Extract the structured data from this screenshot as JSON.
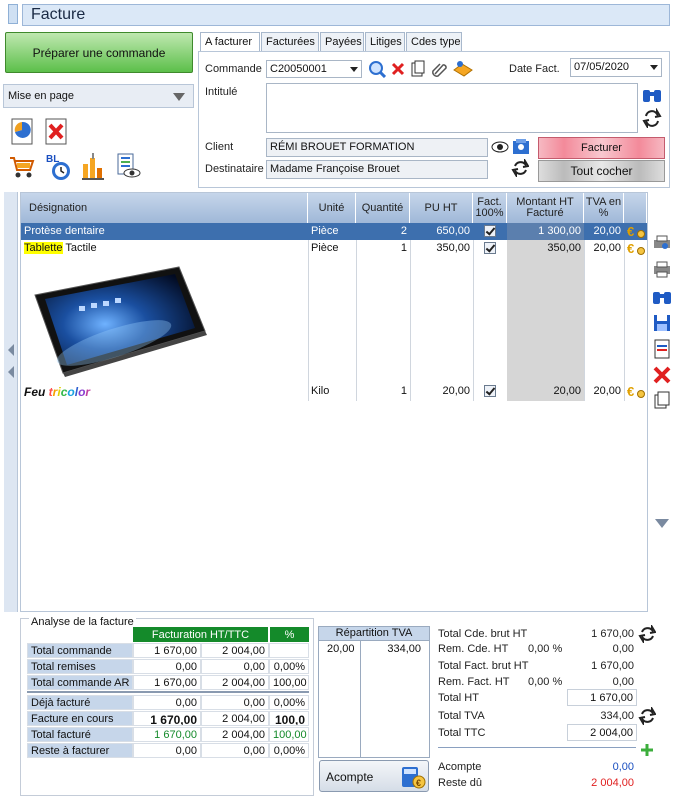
{
  "window": {
    "title": "Facture"
  },
  "left": {
    "prepare_button": "Préparer une commande",
    "mise_en_page": "Mise en page"
  },
  "tabs": [
    "A facturer",
    "Facturées",
    "Payées",
    "Litiges",
    "Cdes type"
  ],
  "form": {
    "commande_label": "Commande",
    "commande_value": "C20050001",
    "date_label": "Date Fact.",
    "date_value": "07/05/2020",
    "intitule_label": "Intitulé",
    "intitule_value": "",
    "client_label": "Client",
    "client_value": "RÉMI BROUET FORMATION",
    "destinataire_label": "Destinataire",
    "destinataire_value": "Madame Françoise Brouet",
    "facturer_button": "Facturer",
    "tout_cocher_button": "Tout cocher"
  },
  "grid": {
    "columns": [
      "Désignation",
      "Unité",
      "Quantité",
      "PU HT",
      "Fact. 100%",
      "Montant HT Facturé",
      "TVA en %"
    ],
    "rows": [
      {
        "designation": "Protèse dentaire",
        "unite": "Pièce",
        "quantite": "2",
        "pu": "650,00",
        "fact": true,
        "montant": "1 300,00",
        "tva": "20,00",
        "selected": true
      },
      {
        "designation_hl": "Tablette",
        "designation_rest": " Tactile",
        "unite": "Pièce",
        "quantite": "1",
        "pu": "350,00",
        "fact": true,
        "montant": "350,00",
        "tva": "20,00"
      },
      {
        "designation_parts": [
          "Feu ",
          "t",
          "r",
          "i",
          "c",
          "o",
          "l",
          "o",
          "r"
        ],
        "unite": "Kilo",
        "quantite": "1",
        "pu": "20,00",
        "fact": true,
        "montant": "20,00",
        "tva": "20,00"
      }
    ]
  },
  "analyse": {
    "title": "Analyse de la facture",
    "head": {
      "fact": "Facturation HT/TTC",
      "pct": "%"
    },
    "rows1": [
      {
        "label": "Total commande",
        "ht": "1 670,00",
        "ttc": "2 004,00",
        "pct": ""
      },
      {
        "label": "Total remises",
        "ht": "0,00",
        "ttc": "0,00",
        "pct": "0,00%"
      },
      {
        "label": "Total commande AR",
        "ht": "1 670,00",
        "ttc": "2 004,00",
        "pct": "100,00"
      }
    ],
    "rows2": [
      {
        "label": "Déjà facturé",
        "ht": "0,00",
        "ttc": "0,00",
        "pct": "0,00%"
      },
      {
        "label": "Facture en cours",
        "ht": "1 670,00",
        "ttc": "2 004,00",
        "pct": "100,0"
      },
      {
        "label": "Total facturé",
        "ht": "1 670,00",
        "ttc": "2 004,00",
        "pct": "100,00"
      },
      {
        "label": "Reste à facturer",
        "ht": "0,00",
        "ttc": "0,00",
        "pct": "0,00%"
      }
    ]
  },
  "repartition": {
    "title": "Répartition TVA",
    "rate": "20,00",
    "amount": "334,00"
  },
  "acompte_button": "Acompte",
  "totals": {
    "cde_brut_label": "Total Cde. brut HT",
    "cde_brut": "1 670,00",
    "rem_cde_label": "Rem. Cde. HT",
    "rem_cde_pct": "0,00 %",
    "rem_cde": "0,00",
    "fact_brut_label": "Total Fact. brut HT",
    "fact_brut": "1 670,00",
    "rem_fact_label": "Rem. Fact. HT",
    "rem_fact_pct": "0,00 %",
    "rem_fact": "0,00",
    "ht_label": "Total HT",
    "ht": "1 670,00",
    "tva_label": "Total TVA",
    "tva": "334,00",
    "ttc_label": "Total TTC",
    "ttc": "2 004,00",
    "acompte_label": "Acompte",
    "acompte": "0,00",
    "reste_label": "Reste dû",
    "reste": "2 004,00"
  }
}
